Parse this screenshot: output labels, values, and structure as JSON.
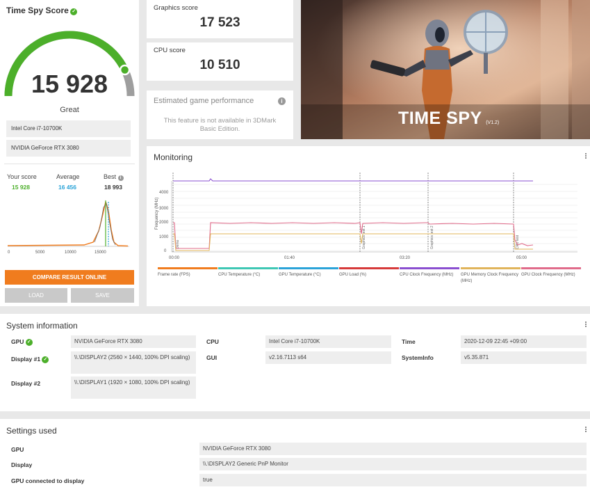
{
  "score_panel": {
    "title": "Time Spy Score",
    "score": "15 928",
    "gauge_fraction": 0.86,
    "rating": "Great",
    "cpu": "Intel Core i7-10700K",
    "gpu": "NVIDIA GeForce RTX 3080",
    "your_score_label": "Your score",
    "your_score": "15 928",
    "average_label": "Average",
    "average": "16 456",
    "best_label": "Best",
    "best": "18 993",
    "x_ticks": [
      "0",
      "5000",
      "10000",
      "15000"
    ],
    "compare_button": "COMPARE RESULT ONLINE",
    "load_button": "LOAD",
    "save_button": "SAVE",
    "colors": {
      "green": "#4caf2a",
      "orange": "#f07c1e",
      "blue": "#2aa3d8"
    }
  },
  "graphics": {
    "label": "Graphics score",
    "value": "17 523"
  },
  "cpu_score": {
    "label": "CPU score",
    "value": "10 510"
  },
  "estimated": {
    "label": "Estimated game performance",
    "message": "This feature is not available in 3DMark Basic Edition."
  },
  "banner": {
    "title": "TIME SPY",
    "version": "(V1.2)"
  },
  "monitoring": {
    "title": "Monitoring",
    "y_axis_label": "Frequency (MHz)",
    "y_ticks": [
      "4000",
      "3000",
      "2000",
      "1000",
      "0"
    ],
    "x_ticks": [
      "00:00",
      "01:40",
      "03:20",
      "05:00"
    ],
    "markers": [
      "Demo",
      "Graphics test 1",
      "Graphics test 2",
      "CPU test"
    ],
    "legend": [
      {
        "label": "Frame rate (FPS)",
        "color": "#f07c1e"
      },
      {
        "label": "CPU Temperature (°C)",
        "color": "#3ec7b4"
      },
      {
        "label": "GPU Temperature (°C)",
        "color": "#2aa3d8"
      },
      {
        "label": "GPU Load (%)",
        "color": "#d63a3a"
      },
      {
        "label": "CPU Clock Frequency (MHz)",
        "color": "#8a4fd0"
      },
      {
        "label": "GPU Memory Clock Frequency (MHz)",
        "color": "#e0b45a"
      },
      {
        "label": "GPU Clock Frequency (MHz)",
        "color": "#e06b8a"
      }
    ]
  },
  "system_info": {
    "title": "System information",
    "gpu_label": "GPU",
    "gpu_value": "NVIDIA GeForce RTX 3080",
    "display1_label": "Display #1",
    "display1_value": "\\\\.\\DISPLAY2 (2560 × 1440, 100% DPI scaling)",
    "display2_label": "Display #2",
    "display2_value": "\\\\.\\DISPLAY1 (1920 × 1080, 100% DPI scaling)",
    "cpu_label": "CPU",
    "cpu_value": "Intel Core i7-10700K",
    "gui_label": "GUI",
    "gui_value": "v2.16.7113 s64",
    "time_label": "Time",
    "time_value": "2020-12-09 22:45 +09:00",
    "sysinfo_label": "SystemInfo",
    "sysinfo_value": "v5.35.871"
  },
  "settings": {
    "title": "Settings used",
    "rows": [
      {
        "label": "GPU",
        "value": "NVIDIA GeForce RTX 3080"
      },
      {
        "label": "Display",
        "value": "\\\\.\\DISPLAY2 Generic PnP Monitor"
      },
      {
        "label": "GPU connected to display",
        "value": "true"
      }
    ]
  }
}
